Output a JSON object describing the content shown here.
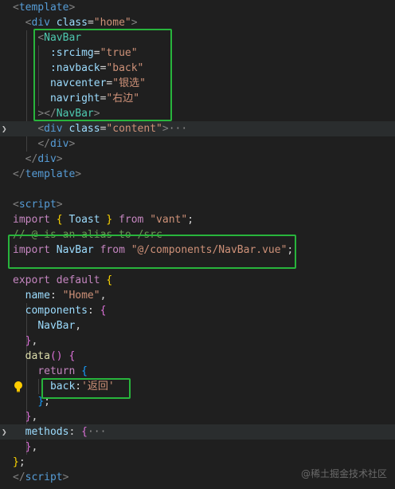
{
  "editor": {
    "lines": [
      [
        [
          "<",
          "tk-punc"
        ],
        [
          "template",
          "tk-tag"
        ],
        [
          ">",
          "tk-punc"
        ]
      ],
      [
        [
          "  "
        ],
        [
          "<",
          "tk-punc"
        ],
        [
          "div",
          "tk-tag"
        ],
        [
          " "
        ],
        [
          "class",
          "tk-attr"
        ],
        [
          "=",
          "tk-plain"
        ],
        [
          "\"home\"",
          "tk-str"
        ],
        [
          ">",
          "tk-punc"
        ]
      ],
      [
        [
          "    "
        ],
        [
          "<",
          "tk-punc"
        ],
        [
          "NavBar",
          "tk-comp"
        ]
      ],
      [
        [
          "      "
        ],
        [
          ":srcimg",
          "tk-attr"
        ],
        [
          "=",
          "tk-plain"
        ],
        [
          "\"true\"",
          "tk-str"
        ]
      ],
      [
        [
          "      "
        ],
        [
          ":navback",
          "tk-attr"
        ],
        [
          "=",
          "tk-plain"
        ],
        [
          "\"back\"",
          "tk-str"
        ]
      ],
      [
        [
          "      "
        ],
        [
          "navcenter",
          "tk-attr"
        ],
        [
          "=",
          "tk-plain"
        ],
        [
          "\"银选\"",
          "tk-str"
        ]
      ],
      [
        [
          "      "
        ],
        [
          "navright",
          "tk-attr"
        ],
        [
          "=",
          "tk-plain"
        ],
        [
          "\"右边\"",
          "tk-str"
        ]
      ],
      [
        [
          "    "
        ],
        [
          "></",
          "tk-punc"
        ],
        [
          "NavBar",
          "tk-comp"
        ],
        [
          ">",
          "tk-punc"
        ]
      ],
      [
        [
          "    "
        ],
        [
          "<",
          "tk-punc"
        ],
        [
          "div",
          "tk-tag"
        ],
        [
          " "
        ],
        [
          "class",
          "tk-attr"
        ],
        [
          "=",
          "tk-plain"
        ],
        [
          "\"content\"",
          "tk-str"
        ],
        [
          ">",
          "tk-punc"
        ],
        [
          "···",
          "tk-ellip"
        ]
      ],
      [
        [
          "    "
        ],
        [
          "</",
          "tk-punc"
        ],
        [
          "div",
          "tk-tag"
        ],
        [
          ">",
          "tk-punc"
        ]
      ],
      [
        [
          "  "
        ],
        [
          "</",
          "tk-punc"
        ],
        [
          "div",
          "tk-tag"
        ],
        [
          ">",
          "tk-punc"
        ]
      ],
      [
        [
          "</",
          "tk-punc"
        ],
        [
          "template",
          "tk-tag"
        ],
        [
          ">",
          "tk-punc"
        ]
      ],
      [],
      [
        [
          "<",
          "tk-punc"
        ],
        [
          "script",
          "tk-tag"
        ],
        [
          ">",
          "tk-punc"
        ]
      ],
      [
        [
          "import",
          "tk-kw"
        ],
        [
          " "
        ],
        [
          "{",
          "tk-brace"
        ],
        [
          " Toast ",
          "tk-ident"
        ],
        [
          "}",
          "tk-brace"
        ],
        [
          " "
        ],
        [
          "from",
          "tk-kw"
        ],
        [
          " "
        ],
        [
          "\"vant\"",
          "tk-str"
        ],
        [
          ";",
          "tk-plain"
        ]
      ],
      [
        [
          "// @ is an alias to /src",
          "tk-comment"
        ]
      ],
      [
        [
          "import",
          "tk-kw"
        ],
        [
          " "
        ],
        [
          "NavBar",
          "tk-ident"
        ],
        [
          " "
        ],
        [
          "from",
          "tk-kw"
        ],
        [
          " "
        ],
        [
          "\"@/components/NavBar.vue\"",
          "tk-str"
        ],
        [
          ";",
          "tk-plain"
        ]
      ],
      [],
      [
        [
          "export",
          "tk-kw"
        ],
        [
          " "
        ],
        [
          "default",
          "tk-kw"
        ],
        [
          " "
        ],
        [
          "{",
          "tk-brace"
        ]
      ],
      [
        [
          "  "
        ],
        [
          "name",
          "tk-ident"
        ],
        [
          ": ",
          "tk-plain"
        ],
        [
          "\"Home\"",
          "tk-str"
        ],
        [
          ",",
          "tk-plain"
        ]
      ],
      [
        [
          "  "
        ],
        [
          "components",
          "tk-ident"
        ],
        [
          ": ",
          "tk-plain"
        ],
        [
          "{",
          "tk-brace2"
        ]
      ],
      [
        [
          "    "
        ],
        [
          "NavBar",
          "tk-ident"
        ],
        [
          ",",
          "tk-plain"
        ]
      ],
      [
        [
          "  "
        ],
        [
          "}",
          "tk-brace2"
        ],
        [
          ",",
          "tk-plain"
        ]
      ],
      [
        [
          "  "
        ],
        [
          "data",
          "tk-fn"
        ],
        [
          "()",
          "tk-brace2"
        ],
        [
          " "
        ],
        [
          "{",
          "tk-brace2"
        ]
      ],
      [
        [
          "    "
        ],
        [
          "return",
          "tk-kw"
        ],
        [
          " "
        ],
        [
          "{",
          "tk-brace3"
        ]
      ],
      [
        [
          "      "
        ],
        [
          "back",
          "tk-ident"
        ],
        [
          ":",
          "tk-plain"
        ],
        [
          "'返回'",
          "tk-str"
        ]
      ],
      [
        [
          "    "
        ],
        [
          "}",
          "tk-brace3"
        ],
        [
          ";",
          "tk-plain"
        ]
      ],
      [
        [
          "  "
        ],
        [
          "}",
          "tk-brace2"
        ],
        [
          ",",
          "tk-plain"
        ]
      ],
      [
        [
          "  "
        ],
        [
          "methods",
          "tk-ident"
        ],
        [
          ": ",
          "tk-plain"
        ],
        [
          "{",
          "tk-brace2"
        ],
        [
          "···",
          "tk-ellip"
        ]
      ],
      [
        [
          "  "
        ],
        [
          "}",
          "tk-brace2"
        ],
        [
          ",",
          "tk-plain"
        ]
      ],
      [
        [
          "}",
          "tk-brace"
        ],
        [
          ";",
          "tk-plain"
        ]
      ],
      [
        [
          "</",
          "tk-punc"
        ],
        [
          "script",
          "tk-tag"
        ],
        [
          ">",
          "tk-punc"
        ]
      ]
    ],
    "folded_lines": [
      8,
      28
    ],
    "lightbulb_line": 25
  },
  "watermark": "@稀土掘金技术社区",
  "highlight_color": "#28b43c"
}
